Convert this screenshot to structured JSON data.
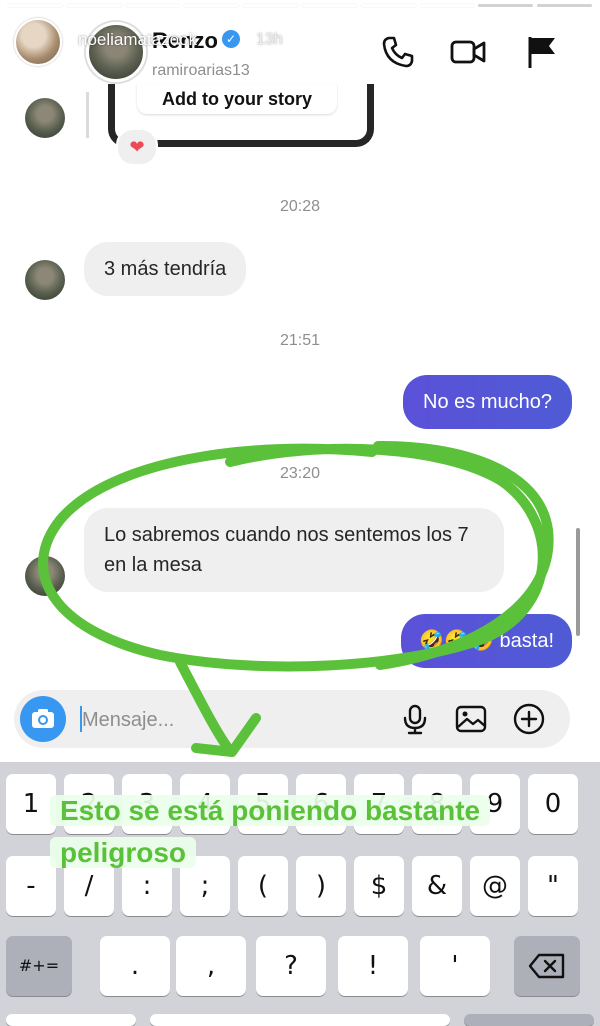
{
  "story": {
    "username": "noeliamatazook",
    "time": "13h"
  },
  "dm": {
    "name": "Renzo",
    "handle": "ramiroarias13",
    "shared_story_cta": "Add to your story",
    "reaction": "❤"
  },
  "messages": [
    {
      "type": "timestamp",
      "text": "20:28"
    },
    {
      "type": "incoming",
      "text": "3 más tendría"
    },
    {
      "type": "timestamp",
      "text": "21:51"
    },
    {
      "type": "outgoing",
      "text": "No es mucho?"
    },
    {
      "type": "timestamp",
      "text": "23:20"
    },
    {
      "type": "incoming",
      "text": "Lo sabremos cuando nos sentemos los 7 en la mesa"
    },
    {
      "type": "outgoing",
      "text": "🤣🤣🤣 basta!"
    }
  ],
  "composer": {
    "placeholder": "Mensaje..."
  },
  "keyboard": {
    "row1": [
      "1",
      "2",
      "3",
      "4",
      "5",
      "6",
      "7",
      "8",
      "9",
      "0"
    ],
    "row2": [
      "-",
      "/",
      ":",
      ";",
      "(",
      ")",
      "$",
      "&",
      "@",
      "\""
    ],
    "row3_mode": "#+=",
    "row3": [
      ".",
      ",",
      "?",
      "!",
      "'"
    ]
  },
  "annotation": {
    "caption_line1": "Esto se está poniendo bastante",
    "caption_line2": "peligroso",
    "color": "#5cc13a"
  },
  "colors": {
    "outgoing_bubble": "#5b51d8",
    "incoming_bubble": "#efefef",
    "accent": "#3897f0"
  }
}
